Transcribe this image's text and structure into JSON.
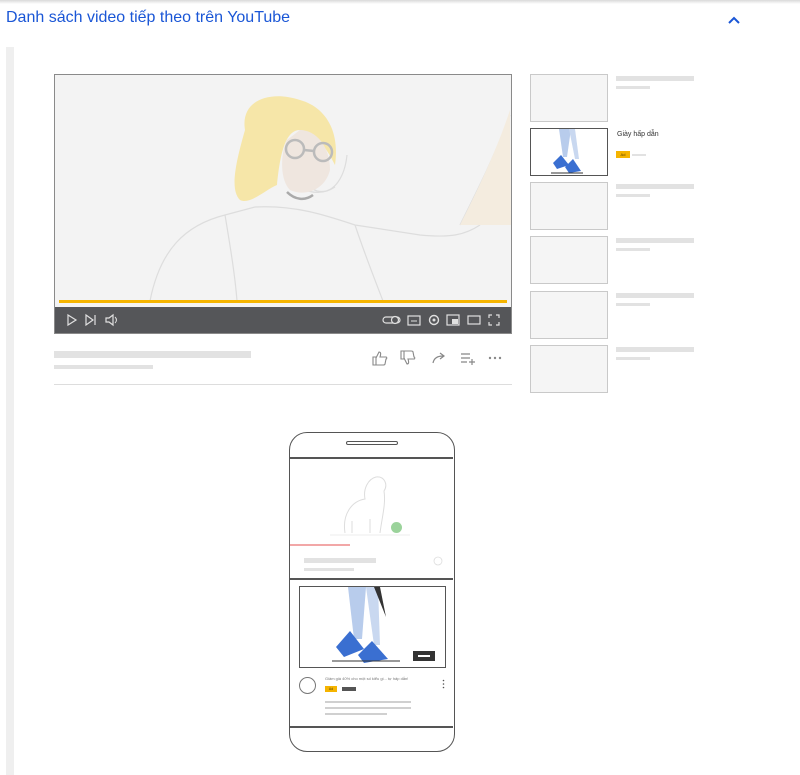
{
  "header": {
    "title": "Danh sách video tiếp theo trên YouTube",
    "collapse_icon": "chevron-up-icon"
  },
  "player": {
    "controls_left": [
      "play-icon",
      "next-icon",
      "volume-icon"
    ],
    "controls_right": [
      "autoplay-toggle-icon",
      "subtitles-icon",
      "settings-icon",
      "miniplayer-icon",
      "theater-mode-icon",
      "fullscreen-icon"
    ],
    "progress_color": "#f5b400"
  },
  "video_actions": [
    "like-icon",
    "dislike-icon",
    "share-icon",
    "save-to-playlist-icon",
    "more-icon"
  ],
  "up_next": {
    "featured_title": "Giày hấp dẫn",
    "ad_badge": "Ad"
  },
  "phone": {
    "ad_caption": "Giảm giá 40% cho một số kiểu gi... tự hấp dẫn!",
    "ad_badge": "Ad"
  },
  "colors": {
    "title_blue": "#1a56d6",
    "ad_yellow": "#f5b400",
    "control_bar": "#555659"
  }
}
